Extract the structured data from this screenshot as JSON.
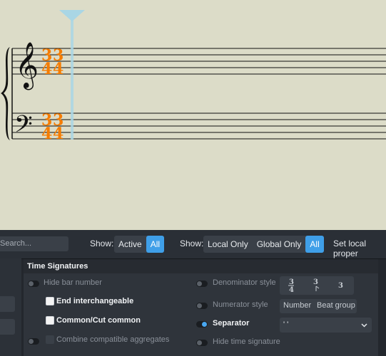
{
  "toolbar": {
    "search_placeholder": "Search...",
    "show_label_1": "Show:",
    "show_active": "Active",
    "show_all_1": "All",
    "show_label_2": "Show:",
    "local_only": "Local Only",
    "global_only": "Global Only",
    "show_all_2": "All",
    "set_local": "Set local proper"
  },
  "section": {
    "title": "Time Signatures",
    "left": {
      "hide_bar_number": "Hide bar number",
      "end_interchangeable": "End interchangeable",
      "common_cut": "Common/Cut common",
      "combine_aggregates": "Combine compatible aggregates"
    },
    "right": {
      "denominator_style": "Denominator style",
      "numerator_style": "Numerator style",
      "separator": "Separator",
      "separator_value": "' '",
      "hide_time_signature": "Hide time signature",
      "numerator_number": "Number",
      "numerator_beat_group": "Beat group"
    }
  },
  "score": {
    "time_sig_numerator": "3",
    "time_sig_denominator": "4"
  },
  "colors": {
    "accent": "#3f9fe8",
    "timesig_orange": "#f57c00",
    "caret": "#a9d6e5"
  }
}
